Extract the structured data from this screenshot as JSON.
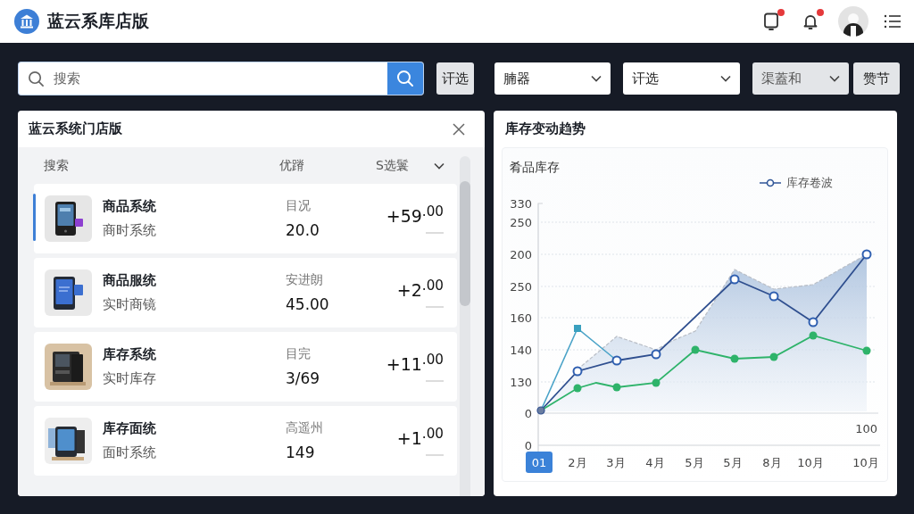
{
  "header": {
    "title": "蓝云系库店版",
    "notifications": [
      {
        "kind": "tablet",
        "unread": true
      },
      {
        "kind": "bell",
        "unread": true
      }
    ]
  },
  "toolbar": {
    "search": {
      "placeholder": "搜索"
    },
    "controls": [
      {
        "kind": "button",
        "label": "讦选"
      },
      {
        "kind": "dropdown",
        "label": "腩器",
        "disabled": false
      },
      {
        "kind": "dropdown",
        "label": "讦选",
        "disabled": false
      },
      {
        "kind": "dropdown",
        "label": "渠蓋和",
        "disabled": true
      },
      {
        "kind": "button",
        "label": "赞节"
      }
    ]
  },
  "inventory_panel": {
    "title": "蓝云系统门店版",
    "columns": [
      "搜索",
      "优蹐",
      "S选鬟"
    ],
    "rows": [
      {
        "name": "商品系统",
        "subtitle": "商时系统",
        "status": "目况",
        "value": "20.0",
        "amount": "+59$^{.00}$",
        "selected": true
      },
      {
        "name": "商品服统",
        "subtitle": "实时商镜",
        "status": "安进朗",
        "value": "45.00",
        "amount": "+2$^{.00}$",
        "selected": false
      },
      {
        "name": "库存系统",
        "subtitle": "实时库存",
        "status": "目完",
        "value": "3/69",
        "amount": "+11$^{.00}$",
        "selected": false
      },
      {
        "name": "库存面统",
        "subtitle": "面时系统",
        "status": "高遥州",
        "value": "149",
        "amount": "+1$^{.00}$",
        "selected": false
      }
    ]
  },
  "chart_panel": {
    "title": "库存变动趋势",
    "subtitle": "肴品库存",
    "legend": "库存卷波",
    "y_labels": [
      "330",
      "250",
      "200",
      "250",
      "160",
      "140",
      "130",
      "0",
      "0"
    ],
    "x_labels": [
      {
        "label": "01",
        "selected": true
      },
      {
        "label": "2月",
        "selected": false
      },
      {
        "label": "3月",
        "selected": false
      },
      {
        "label": "4月",
        "selected": false
      },
      {
        "label": "5月",
        "selected": false
      },
      {
        "label": "5月",
        "selected": false
      },
      {
        "label": "8月",
        "selected": false
      },
      {
        "label": "10月",
        "selected": false
      },
      {
        "label": "10月",
        "selected": false
      }
    ],
    "corner_label": "100"
  }
}
